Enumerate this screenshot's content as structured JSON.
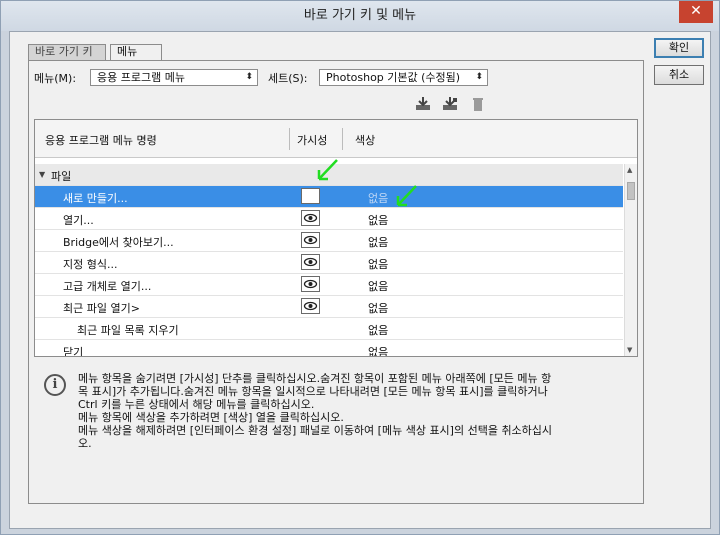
{
  "window": {
    "title": "바로 가기 키 및 메뉴",
    "close_glyph": "✕"
  },
  "tabs": [
    {
      "label": "바로 가기 키"
    },
    {
      "label": "메뉴"
    }
  ],
  "buttons": {
    "ok": "확인",
    "cancel": "취소"
  },
  "controls": {
    "menu_label": "메뉴(M):",
    "menu_value": "응용 프로그램 메뉴",
    "set_label": "세트(S):",
    "set_value": "Photoshop 기본값 (수정됨)"
  },
  "toolbar": {
    "icons": [
      "save-set-icon",
      "save-set-as-icon",
      "delete-set-icon"
    ]
  },
  "table": {
    "headers": {
      "name": "응용 프로그램 메뉴 명령",
      "visibility": "가시성",
      "color": "색상"
    },
    "group": "파일",
    "rows": [
      {
        "name": "새로 만들기...",
        "color": "없음",
        "selected": true,
        "eye": false
      },
      {
        "name": "열기...",
        "color": "없음",
        "selected": false,
        "eye": true
      },
      {
        "name": "Bridge에서 찾아보기...",
        "color": "없음",
        "selected": false,
        "eye": true
      },
      {
        "name": "지정 형식...",
        "color": "없음",
        "selected": false,
        "eye": true
      },
      {
        "name": "고급 개체로 열기...",
        "color": "없음",
        "selected": false,
        "eye": true
      },
      {
        "name": "최근 파일 열기>",
        "color": "없음",
        "selected": false,
        "eye": true
      },
      {
        "name": "최근 파일 목록 지우기",
        "color": "없음",
        "selected": false,
        "eye": false,
        "indent": 2
      },
      {
        "name": "닫기",
        "color": "없음",
        "selected": false,
        "eye": false
      }
    ]
  },
  "info": {
    "text": "메뉴 항목을 숨기려면 [가시성] 단추를 클릭하십시오.숨겨진 항목이 포함된 메뉴 아래쪽에 [모든 메뉴 항\n목 표시]가 추가됩니다.숨겨진 메뉴 항목을 일시적으로 나타내려면 [모든 메뉴 항목 표시]를 클릭하거나\nCtrl 키를 누른 상태에서 해당 메뉴를 클릭하십시오.\n메뉴 항목에 색상을 추가하려면 [색상] 열을 클릭하십시오.\n메뉴 색상을 해제하려면 [인터페이스 환경 설정] 패널로 이동하여 [메뉴 색상 표시]의 선택을 취소하십시\n오."
  },
  "colors": {
    "selection": "#3a8ee6",
    "annotation_arrow": "#22dd22"
  }
}
